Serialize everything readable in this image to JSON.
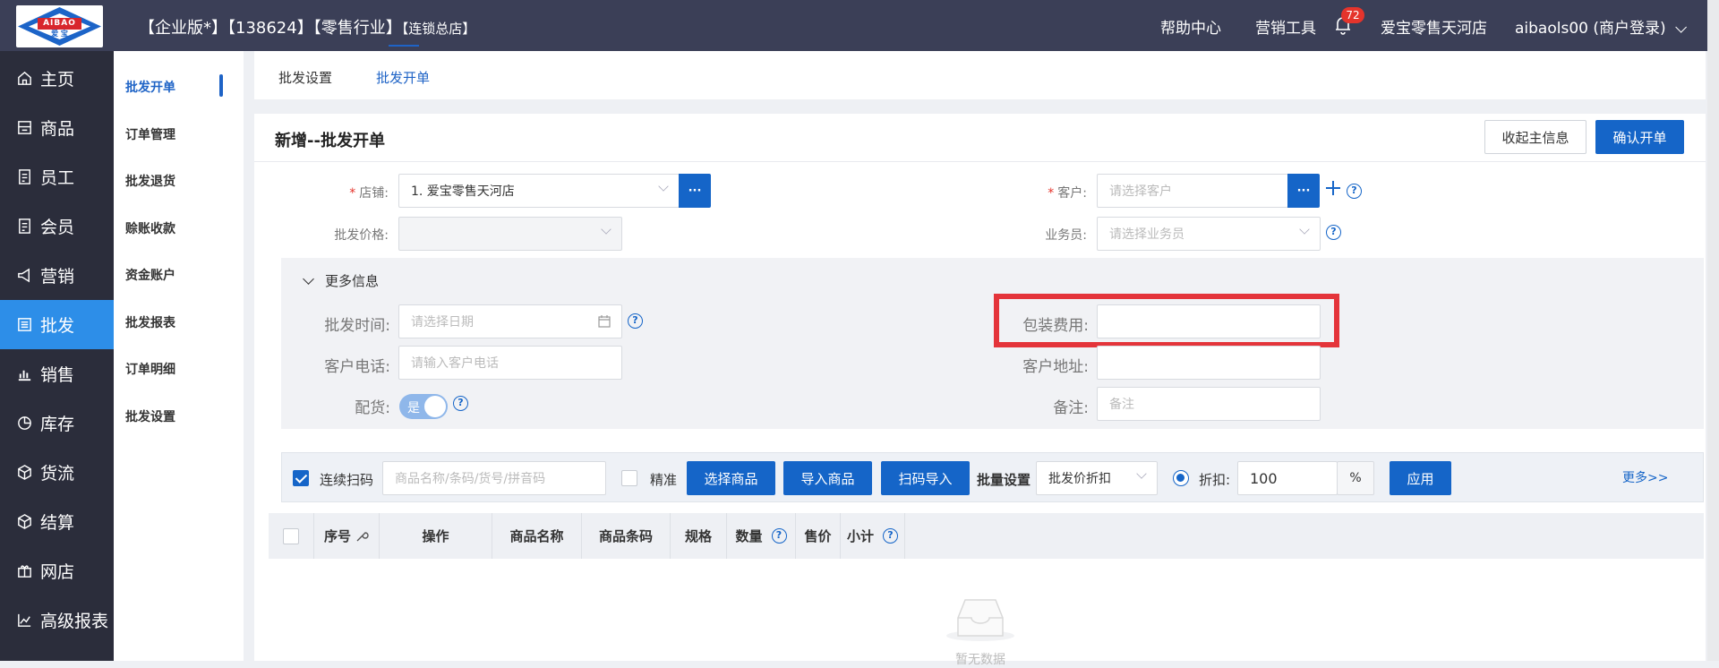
{
  "logo": {
    "band": "AIBAO",
    "sub": "爱 宝"
  },
  "header": {
    "edition": "【企业版*】",
    "id": "【138624】",
    "industry": "【零售行业】",
    "store_type": "【连锁总店】",
    "help": "帮助中心",
    "marketing": "营销工具",
    "notifications": "72",
    "store": "爱宝零售天河店",
    "account": "aibaols00 (商户登录)"
  },
  "sidebar": {
    "items": [
      {
        "label": "主页",
        "icon": "home-icon"
      },
      {
        "label": "商品",
        "icon": "goods-icon"
      },
      {
        "label": "员工",
        "icon": "staff-icon"
      },
      {
        "label": "会员",
        "icon": "member-icon"
      },
      {
        "label": "营销",
        "icon": "megaphone-icon"
      },
      {
        "label": "批发",
        "icon": "list-icon"
      },
      {
        "label": "销售",
        "icon": "chart-icon"
      },
      {
        "label": "库存",
        "icon": "pie-icon"
      },
      {
        "label": "货流",
        "icon": "cube-icon"
      },
      {
        "label": "结算",
        "icon": "cube-icon"
      },
      {
        "label": "网店",
        "icon": "gift-icon"
      },
      {
        "label": "高级报表",
        "icon": "trend-icon"
      }
    ]
  },
  "subnav": {
    "items": [
      "批发开单",
      "订单管理",
      "批发退货",
      "赊账收款",
      "资金账户",
      "批发报表",
      "订单明细",
      "批发设置"
    ]
  },
  "tabs": [
    "批发设置",
    "批发开单"
  ],
  "form": {
    "title": "新增--批发开单",
    "collapse_btn": "收起主信息",
    "confirm_btn": "确认开单",
    "store_label": "店铺:",
    "store_value": "1. 爱宝零售天河店",
    "price_label": "批发价格:",
    "customer_label": "客户:",
    "customer_placeholder": "请选择客户",
    "salesman_label": "业务员:",
    "salesman_placeholder": "请选择业务员",
    "dots": "···",
    "more_info": "更多信息",
    "time_label": "批发时间:",
    "time_placeholder": "请选择日期",
    "phone_label": "客户电话:",
    "phone_placeholder": "请输入客户电话",
    "dispatch_label": "配货:",
    "dispatch_value": "是",
    "pack_label": "包装费用:",
    "address_label": "客户地址:",
    "remark_label": "备注:",
    "remark_placeholder": "备注"
  },
  "toolbar": {
    "scan_label": "连续扫码",
    "search_placeholder": "商品名称/条码/货号/拼音码",
    "exact_label": "精准",
    "select_btn": "选择商品",
    "import_btn": "导入商品",
    "scan_import_btn": "扫码导入",
    "batch_label": "批量设置",
    "batch_value": "批发价折扣",
    "discount_label": "折扣:",
    "discount_value": "100",
    "percent": "%",
    "apply_btn": "应用",
    "more": "更多>>"
  },
  "table": {
    "columns": [
      "序号",
      "操作",
      "商品名称",
      "商品条码",
      "规格",
      "数量",
      "售价",
      "小计"
    ],
    "empty": "暂无数据"
  }
}
